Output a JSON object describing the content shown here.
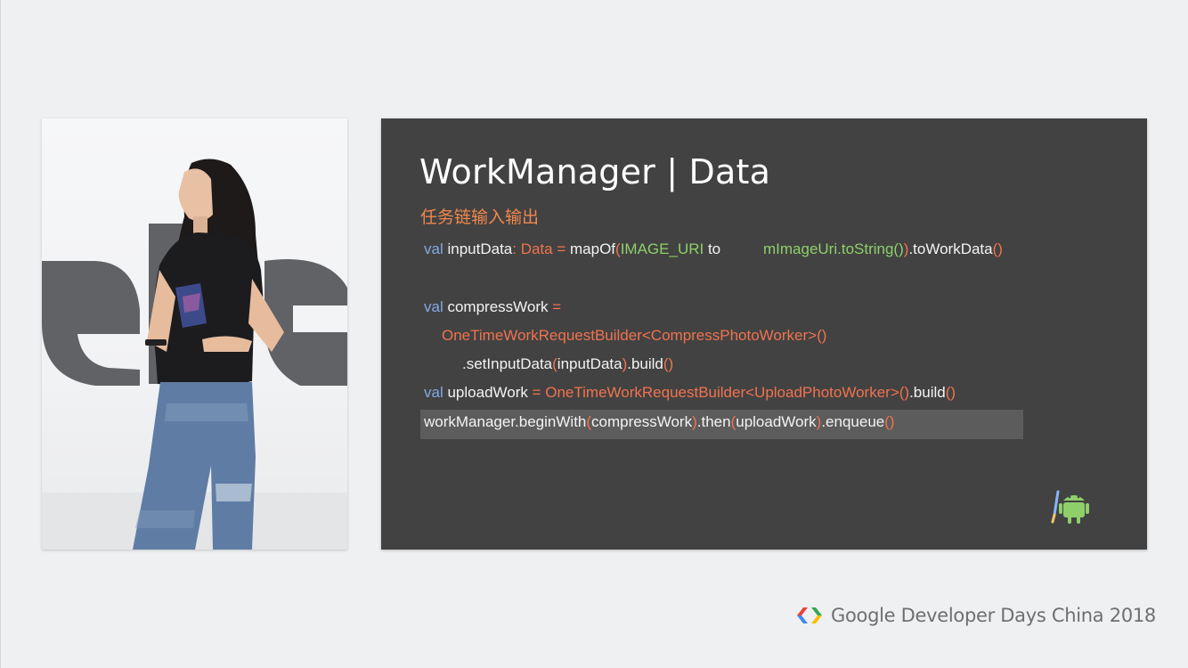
{
  "slide": {
    "title": "WorkManager | Data",
    "subtitle": "任务链输入输出",
    "code": {
      "l1": {
        "a": "val ",
        "b": "inputData",
        "c": ": ",
        "d": "Data",
        "e": " = ",
        "f": "mapOf",
        "g": "(",
        "h": "IMAGE_URI",
        "i": " to",
        "j": "mImageUri.toString()",
        "k": ")",
        "l": ".toWorkData",
        "m": "()"
      },
      "l2": {
        "a": "val ",
        "b": "compressWork",
        "c": " ="
      },
      "l3": {
        "a": "OneTimeWorkRequestBuilder<CompressPhotoWorker>()"
      },
      "l4": {
        "a": ".setInputData",
        "b": "(",
        "c": "inputData",
        "d": ")",
        ".e": "",
        "e": ".build",
        "f": "()"
      },
      "l5": {
        "a": "val ",
        "b": "uploadWork",
        "c": " = ",
        "d": "OneTimeWorkRequestBuilder<UploadPhotoWorker>()",
        "e": ".build",
        "f": "()"
      },
      "l6": {
        "a": "workManager.beginWith",
        "b": "(",
        "c": "compressWork",
        "d": ")",
        "e": ".then",
        "f": "(",
        "g": "uploadWork",
        "h": ")",
        "i": ".enqueue",
        "j": "()"
      }
    }
  },
  "branding": {
    "text": "Google Developer Days China 2018",
    "logo_colors": [
      "#4285f4",
      "#ea4335",
      "#fbbc05",
      "#34a853"
    ]
  },
  "colors": {
    "slide_bg": "#424242",
    "keyword": "#84a9e0",
    "accent": "#f0734e",
    "string": "#8fcf6a"
  }
}
